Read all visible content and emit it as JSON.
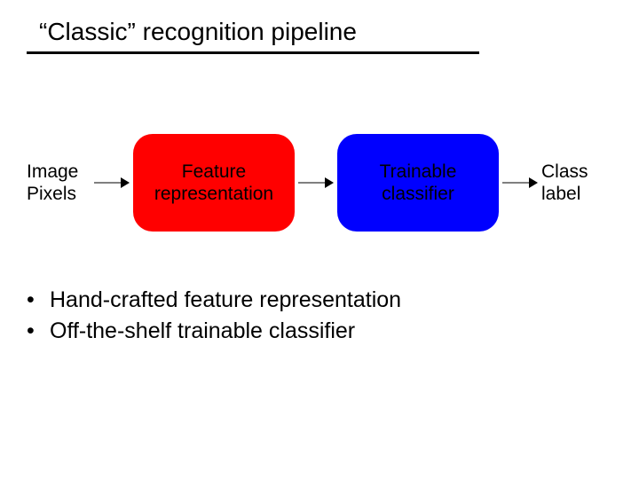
{
  "title": "“Classic” recognition pipeline",
  "pipeline": {
    "input": {
      "line1": "Image",
      "line2": "Pixels"
    },
    "stage1": {
      "line1": "Feature",
      "line2": "representation"
    },
    "stage2": {
      "line1": "Trainable",
      "line2": "classifier"
    },
    "output": {
      "line1": "Class",
      "line2": "label"
    }
  },
  "bullets": [
    "Hand-crafted feature representation",
    "Off-the-shelf trainable classifier"
  ],
  "colors": {
    "stage1": "#ff0000",
    "stage2": "#0000ff"
  }
}
